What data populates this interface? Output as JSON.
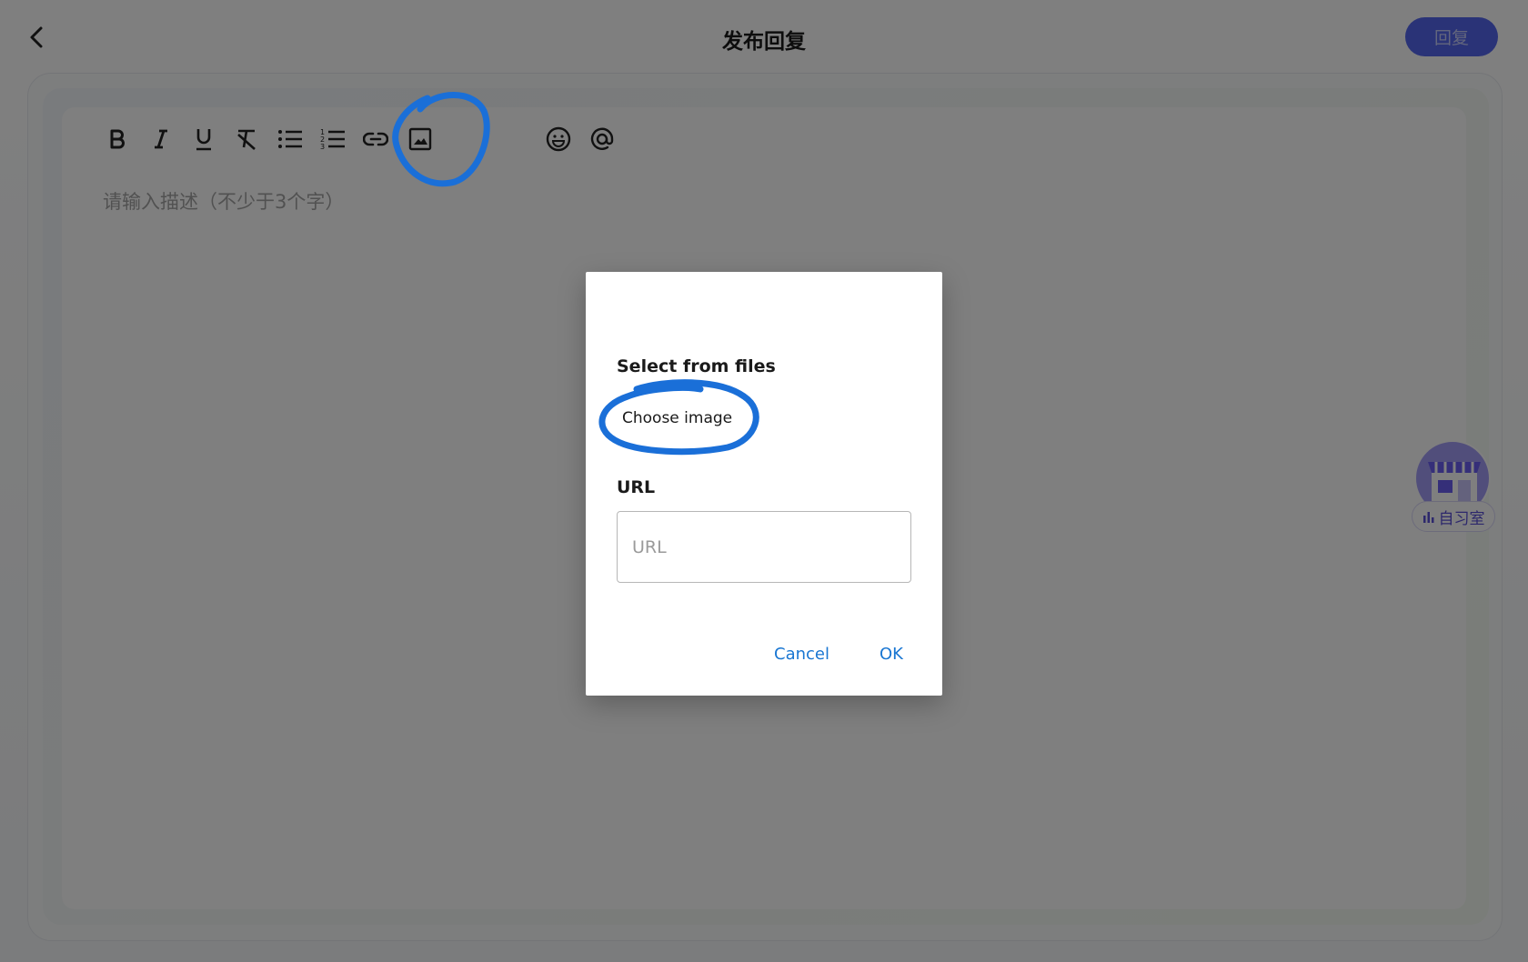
{
  "header": {
    "title": "发布回复",
    "reply_label": "回复"
  },
  "editor": {
    "placeholder": "请输入描述（不少于3个字）",
    "toolbar": [
      "bold-icon",
      "italic-icon",
      "underline-icon",
      "clear-format-icon",
      "bullet-list-icon",
      "numbered-list-icon",
      "link-icon",
      "image-icon",
      "emoji-icon",
      "mention-icon"
    ]
  },
  "float_badge": {
    "label": "自习室"
  },
  "dialog": {
    "files_heading": "Select from files",
    "choose_image_label": "Choose image",
    "url_heading": "URL",
    "url_placeholder": "URL",
    "url_value": "",
    "cancel_label": "Cancel",
    "ok_label": "OK"
  },
  "colors": {
    "accent": "#5566ee",
    "dialog_button": "#1976d2",
    "annotation": "#1a6fd8"
  }
}
